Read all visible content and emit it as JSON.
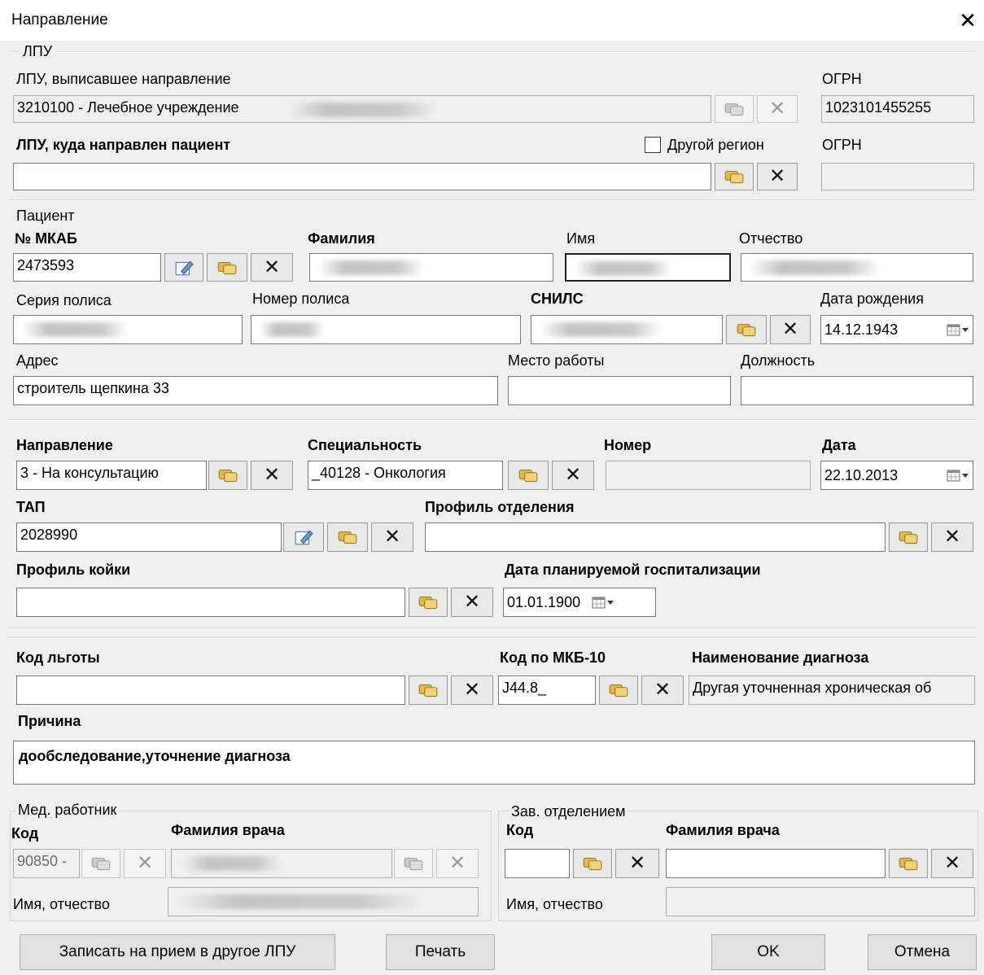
{
  "window": {
    "title": "Направление"
  },
  "lpu": {
    "group_label": "ЛПУ",
    "from_label": "ЛПУ, выписавшее направление",
    "from_value": "3210100 - Лечебное учреждение",
    "ogrn_label": "ОГРН",
    "ogrn_value": "1023101455255",
    "to_label": "ЛПУ, куда направлен пациент",
    "other_region_label": "Другой регион",
    "other_region_checked": false,
    "to_value": "",
    "ogrn2_label": "ОГРН",
    "ogrn2_value": ""
  },
  "patient": {
    "group_label": "Пациент",
    "mkab_label": "№ МКАБ",
    "mkab_value": "2473593",
    "surname_label": "Фамилия",
    "name_label": "Имя",
    "patronymic_label": "Отчество",
    "policy_series_label": "Серия полиса",
    "policy_number_label": "Номер полиса",
    "snils_label": "СНИЛС",
    "birthdate_label": "Дата рождения",
    "birthdate_value": "14.12.1943",
    "address_label": "Адрес",
    "address_value": "строитель щепкина 33",
    "workplace_label": "Место работы",
    "workplace_value": "",
    "position_label": "Должность",
    "position_value": ""
  },
  "referral": {
    "direction_label": "Направление",
    "direction_value": "3 - На консультацию",
    "specialty_label": "Специальность",
    "specialty_value": "_40128 - Онкология",
    "number_label": "Номер",
    "number_value": "",
    "date_label": "Дата",
    "date_value": "22.10.2013",
    "tap_label": "ТАП",
    "tap_value": "2028990",
    "dept_profile_label": "Профиль отделения",
    "dept_profile_value": "",
    "bed_profile_label": "Профиль койки",
    "bed_profile_value": "",
    "planned_date_label": "Дата планируемой госпитализации",
    "planned_date_value": "01.01.1900"
  },
  "diagnosis": {
    "benefit_label": "Код льготы",
    "benefit_value": "",
    "mkb_label": "Код по МКБ-10",
    "mkb_value": "J44.8_",
    "diag_name_label": "Наименование диагноза",
    "diag_name_value": "Другая уточненная хроническая об",
    "reason_label": "Причина",
    "reason_value": "дообследование,уточнение диагноза"
  },
  "med_worker": {
    "group_label": "Мед. работник",
    "code_label": "Код",
    "code_value": "90850 -",
    "doctor_label": "Фамилия врача",
    "name_label": "Имя, отчество"
  },
  "head_dept": {
    "group_label": "Зав. отделением",
    "code_label": "Код",
    "code_value": "",
    "doctor_label": "Фамилия врача",
    "doctor_value": "",
    "name_label": "Имя, отчество",
    "name_value": ""
  },
  "footer": {
    "book_label": "Записать на прием в другое ЛПУ",
    "print_label": "Печать",
    "ok_label": "OK",
    "cancel_label": "Отмена"
  },
  "icons": {
    "lookup": "lookup-icon",
    "clear": "clear-icon",
    "edit": "edit-icon",
    "calendar": "calendar-dropdown-icon"
  }
}
